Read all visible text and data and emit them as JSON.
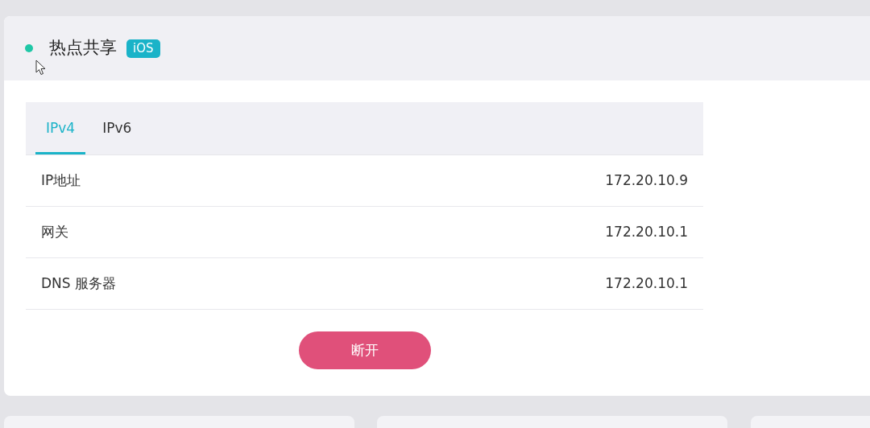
{
  "panel": {
    "title": "热点共享",
    "badge": "iOS"
  },
  "tabs": [
    {
      "label": "IPv4",
      "selected": true
    },
    {
      "label": "IPv6",
      "selected": false
    }
  ],
  "rows": [
    {
      "label": "IP地址",
      "value": "172.20.10.9"
    },
    {
      "label": "网关",
      "value": "172.20.10.1"
    },
    {
      "label": "DNS 服务器",
      "value": "172.20.10.1"
    }
  ],
  "button": "断开"
}
